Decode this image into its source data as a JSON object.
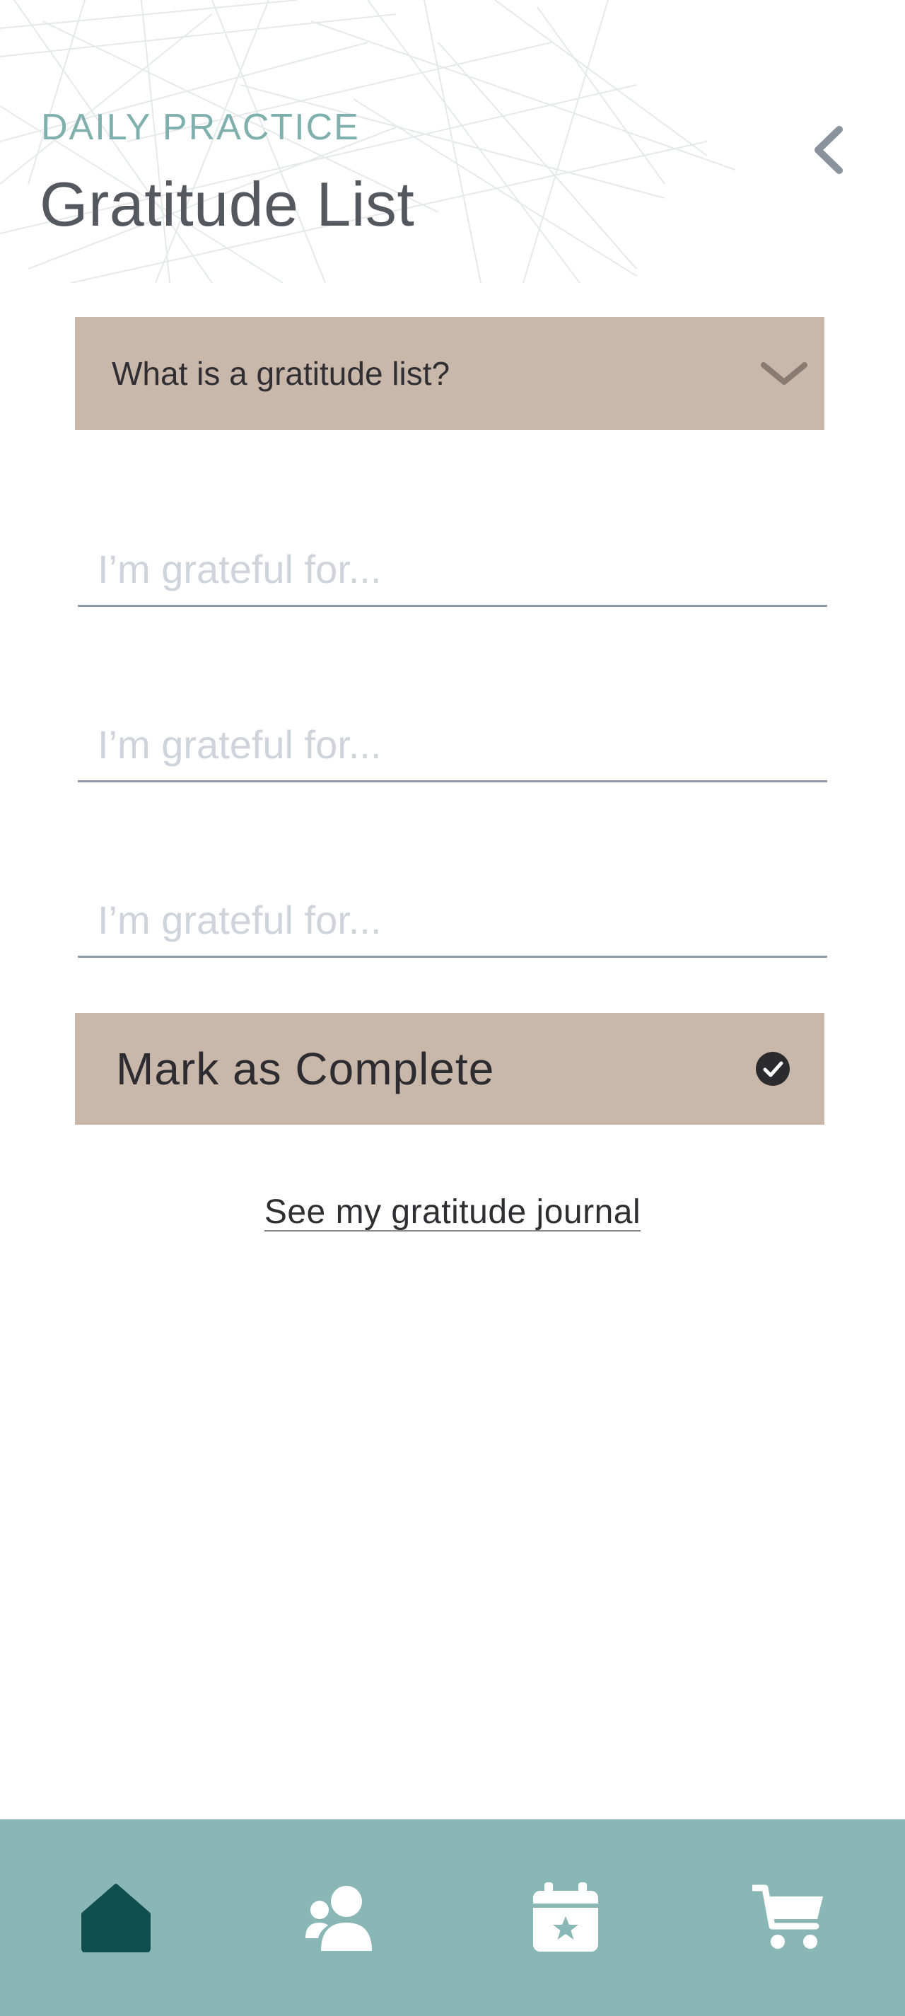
{
  "header": {
    "eyebrow": "DAILY PRACTICE",
    "title": "Gratitude List"
  },
  "accordion": {
    "label": "What is a gratitude list?",
    "icon": "chevron-down-icon"
  },
  "entries": [
    {
      "value": "",
      "placeholder": "I’m grateful for..."
    },
    {
      "value": "",
      "placeholder": "I’m grateful for..."
    },
    {
      "value": "",
      "placeholder": "I’m grateful for..."
    }
  ],
  "complete_button": {
    "label": "Mark as Complete",
    "icon": "check-circle-icon"
  },
  "journal_link": {
    "label": "See my gratitude journal"
  },
  "nav": {
    "items": [
      {
        "icon": "home-icon",
        "active": true
      },
      {
        "icon": "profile-icon",
        "active": false
      },
      {
        "icon": "calendar-star-icon",
        "active": false
      },
      {
        "icon": "cart-icon",
        "active": false
      }
    ]
  },
  "colors": {
    "accent_teal": "#7fb0ae",
    "nav_bar": "#89b7b5",
    "nav_active": "#0f4f4f",
    "button_beige": "#c9b8aa",
    "title_gray": "#55595f"
  }
}
